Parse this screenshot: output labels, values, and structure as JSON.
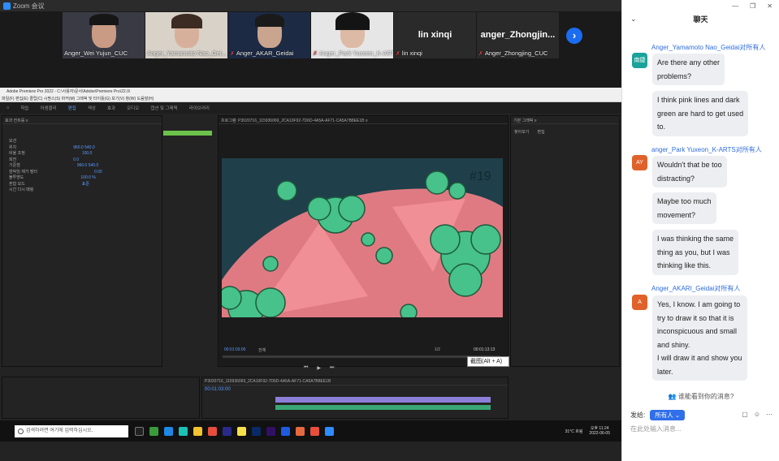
{
  "zoom": {
    "window_title": "Zoom 会议",
    "participants": [
      {
        "name": "Anger_Wei Yujun_CUC",
        "muted": false
      },
      {
        "name": "Anger_Yamamoto Nao_Gei...",
        "muted": false
      },
      {
        "name": "Anger_AKAR_Geidai",
        "muted": true
      },
      {
        "name": "Anger_Park Yuxeon_K-ARTS",
        "muted": true
      },
      {
        "name": "lin xinqi",
        "muted": true,
        "label_large": "lin xinqi"
      },
      {
        "name": "Anger_Zhongjing_CUC",
        "muted": true,
        "label_large": "anger_Zhongjin..."
      }
    ],
    "next_icon": "chevron-right-icon"
  },
  "premiere": {
    "title": "Adobe Premiere Pro 2022 - C:\\사용자\\문서\\Adobe\\Premiere Pro\\22.0\\",
    "menu": "파일(F)   편집(E)   클립(C)   시퀀스(S)   마커(M)   그래픽 및 타이틀(G)   보기(V)   창(W)   도움말(H)",
    "workspaces": [
      "학습",
      "어셈블리",
      "편집",
      "색상",
      "효과",
      "오디오",
      "캡션 및 그래픽",
      "라이브러리"
    ],
    "active_workspace": "편집",
    "effect_controls_tab": "효과 컨트롤 ≡",
    "effect_rows": [
      "모션",
      "위치",
      "비율 조정",
      "회전",
      "기준점",
      "깜박임 제거 필터",
      "불투명도",
      "혼합 모드",
      "시간 다시 매핑"
    ],
    "effect_values": [
      "",
      "960.0   540.0",
      "100.0",
      "0.0",
      "960.0   540.0",
      "0.00",
      "100.0 %",
      "표준",
      ""
    ],
    "program_tab": "프로그램: P3020716_115936069_2CA10F92-7D6D-4A5A-AF71-CA5A7B8EE1B ≡",
    "frame_number": "#19",
    "timecode_left": "00:01:03:00",
    "timecode_right": "00:01:13:13",
    "fit_label": "전체",
    "zoom_ratio": "1/2",
    "right_panel_tab": "기본 그래픽 ≡",
    "right_panel_sub": [
      "찾아보기",
      "편집"
    ],
    "timeline_timecode": "00:01:03:00",
    "timeline_tab": "P3020716_115936069_2CA10F92-7D6D-4A5A-AF71-CA5A7B8EE1B",
    "tooltip": "截图(Alt + A)"
  },
  "taskbar": {
    "search_placeholder": "검색하려면 여기에 입력하십시오.",
    "weather": "31°C 흐림",
    "time": "오후 11:24",
    "date": "2022-06-05"
  },
  "chat": {
    "title": "聊天",
    "messages": [
      {
        "sender": "Anger_Yamamoto Nao_Geidai对所有人",
        "avatar": "南捷",
        "avatar_color": "#1aa39a",
        "lines": [
          [
            "Are there any other",
            "problems?"
          ],
          [
            "I think pink lines and dark",
            "green are hard to get used",
            "to."
          ]
        ]
      },
      {
        "sender": "anger_Park Yuxeon_K-ARTS对所有人",
        "avatar": "AY",
        "avatar_color": "#e0622a",
        "lines": [
          [
            "Wouldn't that be too",
            "distracting?"
          ],
          [
            "Maybe too much",
            "movement?"
          ],
          [
            "I was thinking the same",
            "thing as you, but I was",
            "thinking like this."
          ]
        ]
      },
      {
        "sender": "Anger_AKARI_Geidai对所有人",
        "avatar": "A",
        "avatar_color": "#e0622a",
        "lines": [
          [
            "Yes, I know. I am going to",
            "try to draw it so that it is",
            "inconspicuous and small",
            "and shiny.",
            "I will draw it and show you",
            "later."
          ]
        ]
      }
    ],
    "who_can_see": "谁能看到你的消息?",
    "send_to_label": "发给:",
    "send_to_target": "所有人",
    "input_placeholder": "在此处输入消息..."
  },
  "colors": {
    "accent": "#2d8cff",
    "chat_sender": "#2d6cdf",
    "bubble": "#edeef2"
  }
}
